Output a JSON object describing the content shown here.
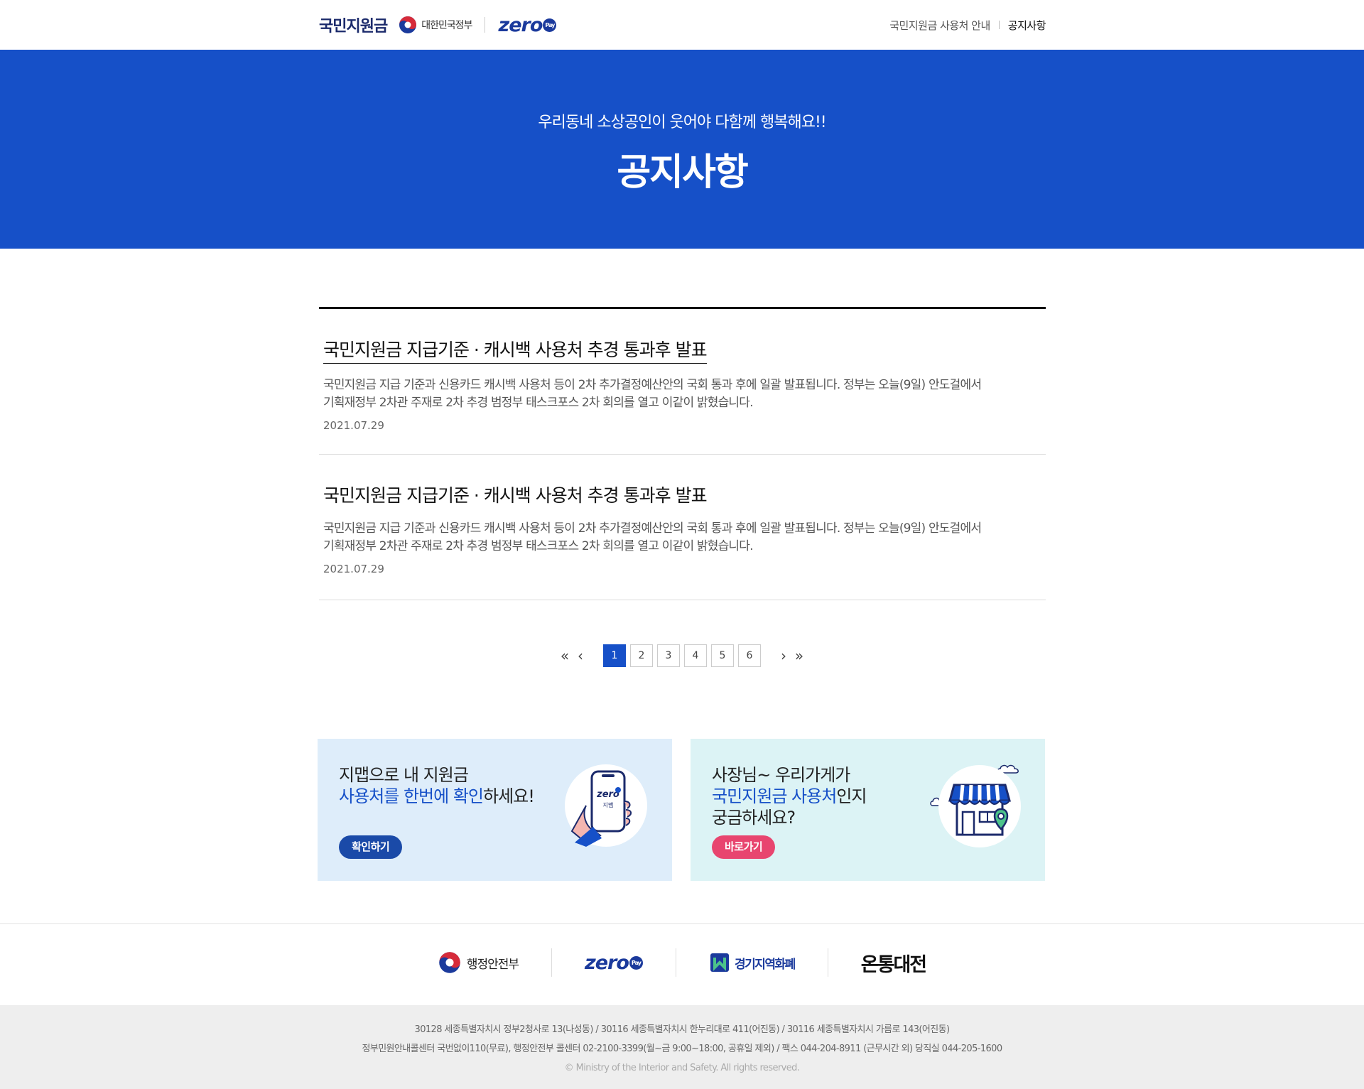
{
  "header": {
    "brand": "국민지원금",
    "gov_label": "대한민국정부",
    "zero_logo": "zero",
    "zero_badge": "Pay",
    "nav": [
      {
        "label": "국민지원금 사용처 안내",
        "active": false
      },
      {
        "label": "공지사항",
        "active": true
      }
    ]
  },
  "hero": {
    "subtitle": "우리동네 소상공인이 웃어야 다함께 행복해요!!",
    "title": "공지사항"
  },
  "notices": [
    {
      "title": "국민지원금 지급기준 · 캐시백 사용처 추경 통과후 발표",
      "desc_line1": "국민지원금 지급 기준과 신용카드 캐시백 사용처 등이 2차 추가결정예산안의 국회 통과 후에 일괄 발표됩니다. 정부는 오늘(9일) 안도걸에서",
      "desc_line2": "기획재정부 2차관 주재로 2차 추경 범정부 태스크포스 2차 회의를 열고 이같이 밝혔습니다.",
      "date": "2021.07.29"
    },
    {
      "title": "국민지원금 지급기준 · 캐시백 사용처 추경 통과후 발표",
      "desc_line1": "국민지원금 지급 기준과 신용카드 캐시백 사용처 등이 2차 추가결정예산안의 국회 통과 후에 일괄 발표됩니다. 정부는 오늘(9일) 안도걸에서",
      "desc_line2": "기획재정부 2차관 주재로 2차 추경 범정부 태스크포스 2차 회의를 열고 이같이 밝혔습니다.",
      "date": "2021.07.29"
    }
  ],
  "pagination": {
    "first": "«",
    "prev": "‹",
    "next": "›",
    "last": "»",
    "pages": [
      "1",
      "2",
      "3",
      "4",
      "5",
      "6"
    ],
    "current": "1"
  },
  "banners": {
    "map": {
      "line1": "지맵으로 내 지원금",
      "line2_highlight": "사용처를 한번에 확인",
      "line2_rest": "하세요!",
      "button": "확인하기",
      "phone_text": "zero",
      "phone_sub": "지맵"
    },
    "shop": {
      "line1": "사장님~ 우리가게가",
      "line2_highlight": "국민지원금 사용처",
      "line2_rest": "인지",
      "line3": "궁금하세요?",
      "button": "바로가기"
    }
  },
  "partners": {
    "mois": "행정안전부",
    "zero": "zero",
    "zero_badge": "Pay",
    "gyeonggi": "경기지역화폐",
    "ontong": "온통대전"
  },
  "footer": {
    "address": "30128 세종특별자치시 정부2청사로 13(나성동) / 30116 세종특별자치시 한누리대로 411(어진동) / 30116 세종특별자치시 가름로 143(어진동)",
    "callcenter": "정부민원안내콜센터 국번없이110(무료), 행정안전부 콜센터 02-2100-3399(월~금 9:00~18:00, 공휴일 제외) / 팩스 044-204-8911 (근무시간 외) 당직실 044-205-1600",
    "copyright": "© Ministry of the Interior and Safety. All rights reserved."
  },
  "colors": {
    "primary_blue": "#1650c8",
    "navy": "#1b3a9c",
    "pink": "#e8456f",
    "banner_blue_bg": "#deedfa",
    "banner_mint_bg": "#dcf3f5"
  }
}
